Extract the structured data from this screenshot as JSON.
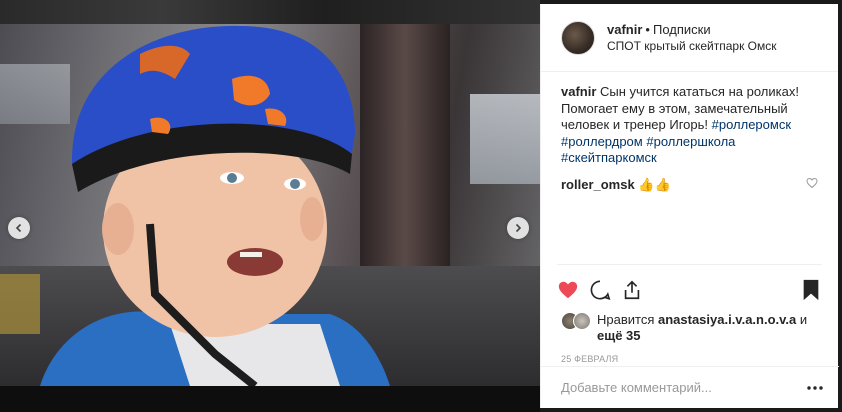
{
  "post": {
    "username": "vafnir",
    "separator": "•",
    "follow_label": "Подписки",
    "location": "СПОТ крытый скейтпарк Омск",
    "caption_user": "vafnir",
    "caption_text": " Сын учится кататься на роликах! Помогает ему в этом, замечательный человек и тренер Игорь! ",
    "hashtags": [
      "#роллеромск",
      "#роллердром",
      "#роллершкола",
      "#скейтпаркомск"
    ],
    "comments": [
      {
        "user": "roller_omsk",
        "text": " 👍👍"
      }
    ],
    "likes_prefix": "Нравится ",
    "likes_user": "anastasiya.i.v.a.n.o.v.a",
    "likes_middle": " и ",
    "likes_more": "ещё 35",
    "date": "25 ФЕВРАЛЯ",
    "comment_placeholder": "Добавьте комментарий...",
    "carousel": {
      "count": 5,
      "active_index": 4
    }
  },
  "colors": {
    "like_red": "#ed4956",
    "link_blue": "#003569",
    "dot_active": "#3897f0"
  },
  "icons": [
    "chevron-left-icon",
    "chevron-right-icon",
    "heart-filled-icon",
    "comment-icon",
    "share-icon",
    "bookmark-filled-icon",
    "heart-outline-icon",
    "more-icon"
  ]
}
